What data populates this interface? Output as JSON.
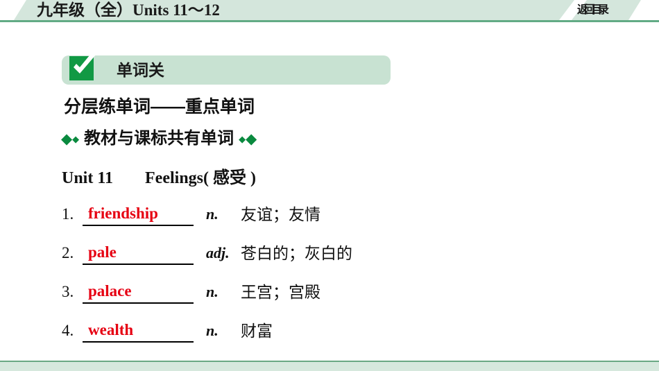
{
  "header": {
    "title": "九年级（全）Units 11～12",
    "return_label": "返回目录"
  },
  "section": {
    "banner_label": "单词关",
    "check_icon": "check-icon",
    "subtitle_main": "分层练单词——重点单词",
    "subtitle_sub": "教材与课标共有单词",
    "diamond_icon": "diamond-icon",
    "accent_green": "#0a8a3f",
    "banner_bg": "#c8e2d2"
  },
  "unit": {
    "number_label": "Unit 11",
    "topic_en": "Feelings(",
    "topic_cn": "感受",
    "topic_close": ")"
  },
  "words": [
    {
      "num": "1.",
      "answer": "friendship",
      "pos": "n.",
      "definition": "友谊；友情"
    },
    {
      "num": "2.",
      "answer": "pale",
      "pos": "adj.",
      "definition": "苍白的；灰白的"
    },
    {
      "num": "3.",
      "answer": "palace",
      "pos": "n.",
      "definition": "王宫；宫殿"
    },
    {
      "num": "4.",
      "answer": "wealth",
      "pos": "n.",
      "definition": "财富"
    }
  ],
  "colors": {
    "answer_red": "#e60012",
    "header_band": "#d4e6dc",
    "header_rule": "#62ab85",
    "footer_fill": "#d6e8dd"
  }
}
